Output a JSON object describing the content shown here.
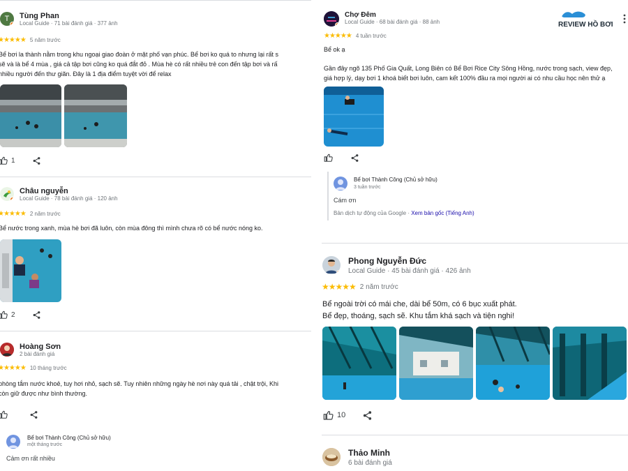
{
  "left": {
    "reviews": [
      {
        "name": "Tùng Phan",
        "avatar_letter": "T",
        "sub": "Local Guide · 71 bài đánh giá · 377 ảnh",
        "stars": "★★★★★",
        "ago": "5 năm trước",
        "lines": [
          "Bể bơi la thành nằm trong khu ngoại giao đoàn ở mặt phố vạn phúc. Bể bơi ko quá to nhưng lại rất s",
          "sẽ và là bể 4 mùa , giá cả tập bơi cũng ko quá đắt đỏ . Mùa hè có rất nhiều trẻ con đến tập bơi và rấ",
          "nhiều người đến thư giãn. Đây là 1 địa điểm tuyệt vời để relax"
        ],
        "likes": "1"
      },
      {
        "name": "Châu nguyễn",
        "sub": "Local Guide · 78 bài đánh giá · 120 ảnh",
        "stars": "★★★★★",
        "ago": "2 năm trước",
        "lines": [
          "Bể nước trong xanh, mùa hè bơi đã luôn, còn mùa đông thì mình chưa rõ có bể nước nóng ko."
        ],
        "likes": "2"
      },
      {
        "name": "Hoàng Sơn",
        "sub": "2 bài đánh giá",
        "stars": "★★★★★",
        "ago": "10 tháng trước",
        "lines": [
          "phòng tắm nước khoẻ, tuy hơi nhỏ, sạch sẽ. Tuy nhiên những ngày hè nơi này quá tải , chật trội, Khi",
          "còn giữ được như bình thường."
        ],
        "owner_name": "Bể bơi Thành Công (Chủ sở hữu)",
        "owner_ago": "một tháng trước",
        "owner_text": "Cảm ơn rất nhiều"
      }
    ]
  },
  "right": {
    "logo_text": "REVIEW HỒ BƠI",
    "reviews": [
      {
        "name": "Chợ Đêm",
        "sub": "Local Guide · 68 bài đánh giá · 88 ảnh",
        "stars": "★★★★★",
        "ago": "4 tuần trước",
        "lines": [
          "Bể ok ạ",
          "Gần đây ngõ 135 Phố Gia Quất, Long Biên có Bể Bơi Rice City Sông Hồng, nước trong sạch, view đẹp,",
          "giá hợp lý, dạy bơi 1 khoá biết bơi luôn, cam kết 100% đầu ra mọi người ai có nhu cầu học nên thử ạ"
        ],
        "owner_name": "Bể bơi Thành Công (Chủ sở hữu)",
        "owner_ago": "3 tuần trước",
        "owner_text": "Cám ơn",
        "translate_note": "Bản dịch tự động của Google ·",
        "translate_link": "Xem bản gốc (Tiếng Anh)"
      },
      {
        "name": "Phong Nguyễn Đức",
        "sub": "Local Guide · 45 bài đánh giá · 426 ảnh",
        "stars": "★★★★★",
        "ago": "2 năm trước",
        "lines": [
          "Bể ngoài trời có mái che, dài bể 50m, có 6 bục xuất phát.",
          "Bể đẹp, thoáng, sạch sẽ. Khu tắm khá sạch và tiện nghi!"
        ],
        "likes": "10"
      },
      {
        "name": "Thảo Minh",
        "sub": "6 bài đánh giá"
      }
    ]
  },
  "icons": {
    "like": "thumbs-up-icon",
    "share": "share-icon",
    "more": "more-vert-icon"
  }
}
